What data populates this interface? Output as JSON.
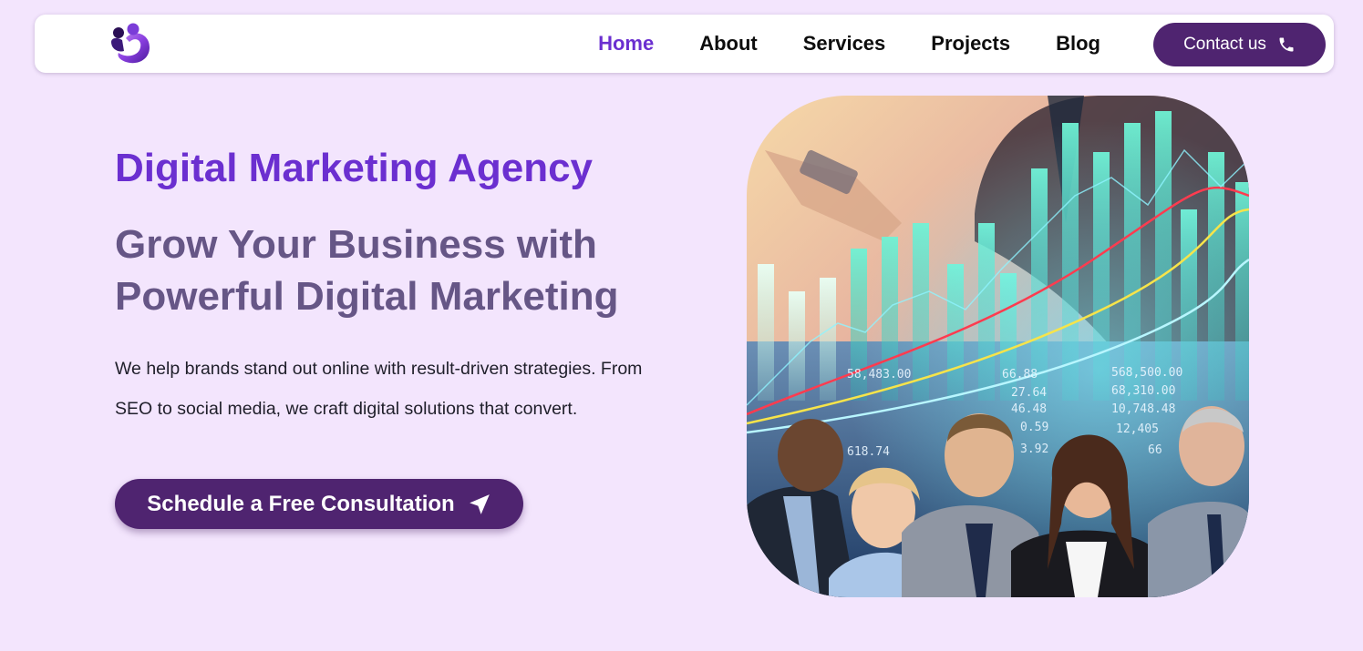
{
  "nav": {
    "logo_icon": "agency-logo-icon",
    "links": [
      "Home",
      "About",
      "Services",
      "Projects",
      "Blog"
    ],
    "active": "Home",
    "contact_label": "Contact us",
    "contact_icon": "phone-icon"
  },
  "hero": {
    "eyebrow": "Digital Marketing Agency",
    "headline_line1": "Grow Your Business with",
    "headline_line2": "Powerful Digital Marketing",
    "description": "We help brands stand out online with result-driven strategies. From SEO to social media, we craft digital solutions that convert.",
    "cta_label": "Schedule a Free Consultation",
    "cta_icon": "send-arrow-icon",
    "image": "business-team-looking-at-growth-chart-photo",
    "image_text": {
      "row1": [
        "58,483.00",
        "66.88",
        "568,500.00"
      ],
      "row2": [
        "27.64",
        "68,310.00"
      ],
      "row3": [
        "46.48",
        "10,748.48"
      ],
      "row4": [
        "0.59",
        "12,405"
      ],
      "row5": [
        "618.74",
        "3.92",
        "66"
      ]
    }
  },
  "colors": {
    "background": "#f3e5fd",
    "accent_purple": "#6b2fd0",
    "headline_gray_purple": "#665686",
    "button_dark_purple": "#4f2470",
    "nav_white": "#ffffff"
  }
}
